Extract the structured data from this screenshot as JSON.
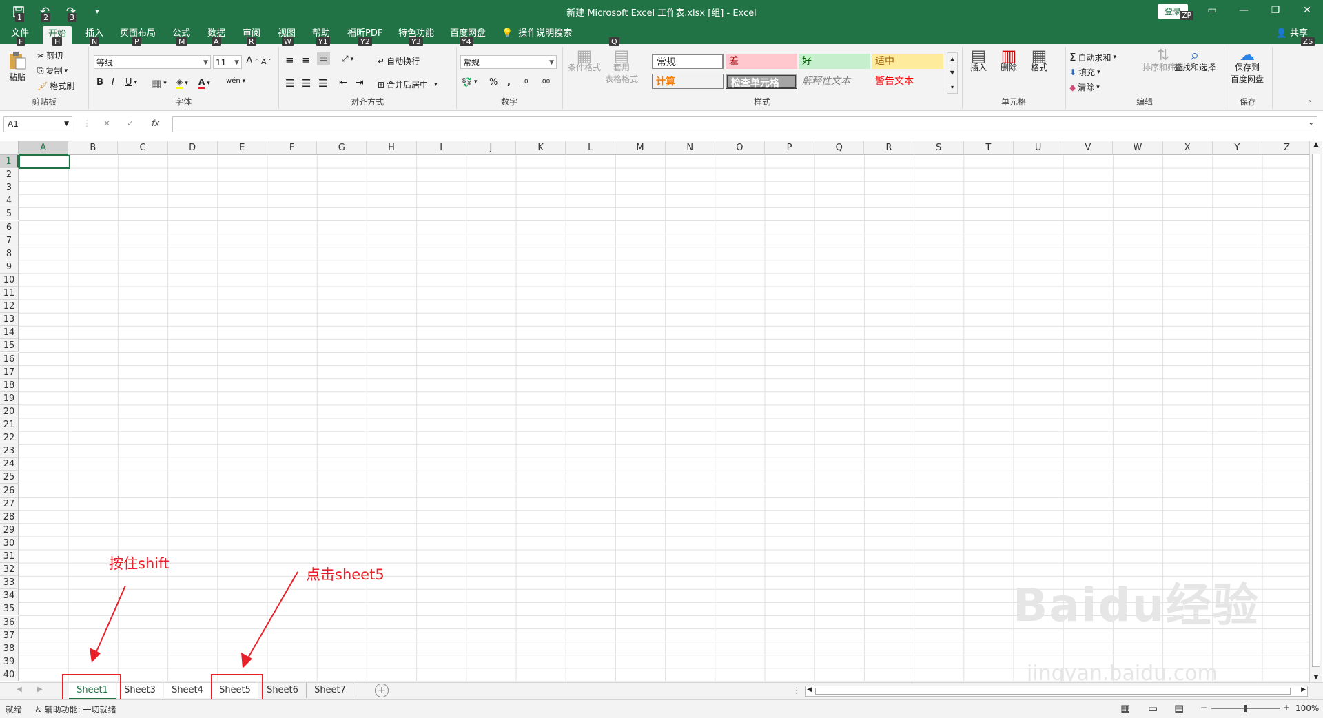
{
  "window": {
    "title": "新建 Microsoft Excel 工作表.xlsx [组] - Excel",
    "login_label": "登录",
    "login_keytip": "ZP",
    "share_label": "共享",
    "share_keytip": "ZS",
    "qat_keytips": [
      "1",
      "2",
      "3"
    ]
  },
  "tabs": [
    {
      "label": "文件",
      "keytip": "F"
    },
    {
      "label": "开始",
      "keytip": "H",
      "active": true
    },
    {
      "label": "插入",
      "keytip": "N"
    },
    {
      "label": "页面布局",
      "keytip": "P"
    },
    {
      "label": "公式",
      "keytip": "M"
    },
    {
      "label": "数据",
      "keytip": "A"
    },
    {
      "label": "审阅",
      "keytip": "R"
    },
    {
      "label": "视图",
      "keytip": "W"
    },
    {
      "label": "帮助",
      "keytip": "Y1"
    },
    {
      "label": "福昕PDF",
      "keytip": "Y2"
    },
    {
      "label": "特色功能",
      "keytip": "Y3"
    },
    {
      "label": "百度网盘",
      "keytip": "Y4"
    }
  ],
  "tell_me": {
    "label": "操作说明搜索",
    "keytip": "Q"
  },
  "ribbon": {
    "clipboard": {
      "group": "剪贴板",
      "paste": "粘贴",
      "cut": "剪切",
      "copy": "复制",
      "format_painter": "格式刷"
    },
    "font": {
      "group": "字体",
      "name": "等线",
      "size": "11",
      "bold": "B",
      "italic": "I",
      "underline": "U",
      "grow": "A",
      "shrink": "A",
      "wen": "wén"
    },
    "alignment": {
      "group": "对齐方式",
      "wrap": "自动换行",
      "merge": "合并后居中"
    },
    "number": {
      "group": "数字",
      "format": "常规",
      "percent": "%",
      "comma": ",",
      "inc": ".0",
      "dec": ".00"
    },
    "styles": {
      "group": "样式",
      "conditional": "条件格式",
      "table_format_1": "套用",
      "table_format_2": "表格格式",
      "cells": [
        "常规",
        "差",
        "好",
        "适中",
        "计算",
        "检查单元格",
        "解释性文本",
        "警告文本"
      ]
    },
    "cells_group": {
      "group": "单元格",
      "insert": "插入",
      "delete": "删除",
      "format": "格式"
    },
    "editing": {
      "group": "编辑",
      "autosum": "自动求和",
      "fill": "填充",
      "clear": "清除",
      "sort": "排序和筛选",
      "find": "查找和选择"
    },
    "save": {
      "group": "保存",
      "label_1": "保存到",
      "label_2": "百度网盘"
    }
  },
  "formula_bar": {
    "name_box": "A1",
    "fx": "fx",
    "cancel": "✕",
    "enter": "✓"
  },
  "grid": {
    "columns": [
      "A",
      "B",
      "C",
      "D",
      "E",
      "F",
      "G",
      "H",
      "I",
      "J",
      "K",
      "L",
      "M",
      "N",
      "O",
      "P",
      "Q",
      "R",
      "S",
      "T",
      "U",
      "V",
      "W",
      "X",
      "Y",
      "Z"
    ],
    "rows": [
      "1",
      "2",
      "3",
      "4",
      "5",
      "6",
      "7",
      "8",
      "9",
      "10",
      "11",
      "12",
      "13",
      "14",
      "15",
      "16",
      "17",
      "18",
      "19",
      "20",
      "21",
      "22",
      "23",
      "24",
      "25",
      "26",
      "27",
      "28",
      "29",
      "30",
      "31",
      "32",
      "33",
      "34",
      "35",
      "36",
      "37",
      "38",
      "39",
      "40"
    ]
  },
  "sheets": [
    {
      "label": "Sheet1",
      "active": true
    },
    {
      "label": "Sheet3"
    },
    {
      "label": "Sheet4"
    },
    {
      "label": "Sheet5"
    },
    {
      "label": "Sheet6"
    },
    {
      "label": "Sheet7"
    }
  ],
  "status": {
    "ready": "就绪",
    "accessibility": "辅助功能: 一切就绪",
    "zoom": "100%"
  },
  "annotations": {
    "hold_shift": "按住shift",
    "click_sheet5": "点击sheet5"
  },
  "watermark": {
    "text": "Baidu经验",
    "url": "jingyan.baidu.com"
  },
  "colors": {
    "excel_green": "#217346",
    "annotation_red": "#e8202a"
  }
}
